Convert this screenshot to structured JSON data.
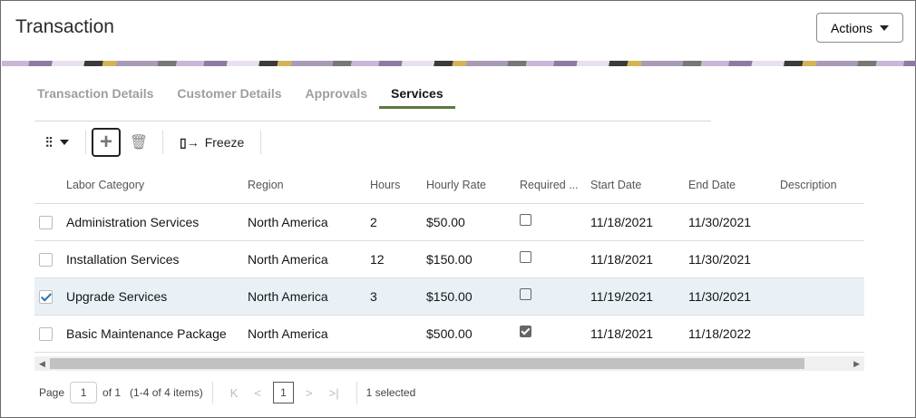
{
  "header": {
    "title": "Transaction",
    "actions_label": "Actions"
  },
  "tabs": [
    {
      "label": "Transaction Details"
    },
    {
      "label": "Customer Details"
    },
    {
      "label": "Approvals"
    },
    {
      "label": "Services"
    }
  ],
  "toolbar": {
    "freeze_label": "Freeze"
  },
  "table": {
    "columns": [
      "Labor Category",
      "Region",
      "Hours",
      "Hourly Rate",
      "Required ...",
      "Start Date",
      "End Date",
      "Description"
    ],
    "rows": [
      {
        "labor": "Administration Services",
        "region": "North America",
        "hours": "2",
        "rate": "$50.00",
        "required": false,
        "start": "11/18/2021",
        "end": "11/30/2021",
        "description": "",
        "selected": false
      },
      {
        "labor": "Installation Services",
        "region": "North America",
        "hours": "12",
        "rate": "$150.00",
        "required": false,
        "start": "11/18/2021",
        "end": "11/30/2021",
        "description": "",
        "selected": false
      },
      {
        "labor": "Upgrade Services",
        "region": "North America",
        "hours": "3",
        "rate": "$150.00",
        "required": false,
        "start": "11/19/2021",
        "end": "11/30/2021",
        "description": "",
        "selected": true
      },
      {
        "labor": "Basic Maintenance Package",
        "region": "North America",
        "hours": "",
        "rate": "$500.00",
        "required": true,
        "start": "11/18/2021",
        "end": "11/18/2022",
        "description": "",
        "selected": false
      }
    ]
  },
  "pager": {
    "page_label": "Page",
    "page_value": "1",
    "of_label": "of 1",
    "items_label": "(1-4 of 4 items)",
    "current": "1",
    "selected_label": "1 selected"
  }
}
